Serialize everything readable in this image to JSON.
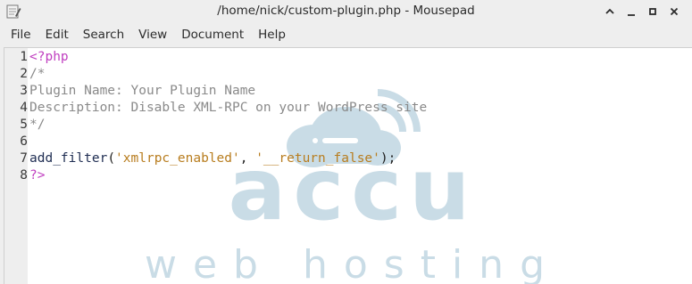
{
  "window": {
    "title": "/home/nick/custom-plugin.php - Mousepad"
  },
  "menu": {
    "items": [
      "File",
      "Edit",
      "Search",
      "View",
      "Document",
      "Help"
    ]
  },
  "editor": {
    "line_numbers": [
      "1",
      "2",
      "3",
      "4",
      "5",
      "6",
      "7",
      "8"
    ],
    "lines": {
      "l1": {
        "open_tag": "<?php"
      },
      "l2": {
        "comment": "/*"
      },
      "l3": {
        "comment": "Plugin Name: Your Plugin Name"
      },
      "l4": {
        "comment": "Description: Disable XML-RPC on your WordPress site"
      },
      "l5": {
        "comment": "*/"
      },
      "l6": {
        "text": ""
      },
      "l7": {
        "func": "add_filter",
        "open_paren": "(",
        "arg1": "'xmlrpc_enabled'",
        "comma": ", ",
        "arg2": "'__return_false'",
        "close": ");"
      },
      "l8": {
        "close_tag": "?>"
      }
    }
  },
  "watermark": {
    "brand": "accu",
    "tagline": "web hosting",
    "color": "#c9dce6"
  },
  "colors": {
    "php_tag": "#c03fc0",
    "comment": "#8a8a8a",
    "function": "#1f2d52",
    "string": "#b87d1f"
  }
}
